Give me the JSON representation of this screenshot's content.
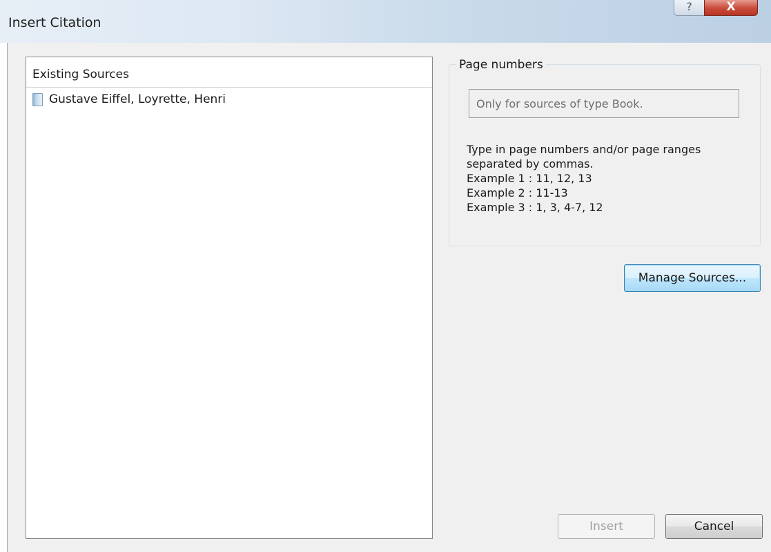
{
  "window": {
    "title": "Insert Citation",
    "help_label": "?",
    "close_label": "X"
  },
  "sources": {
    "header": "Existing Sources",
    "items": [
      {
        "label": "Gustave Eiffel, Loyrette, Henri",
        "icon": "book-icon"
      }
    ]
  },
  "page_numbers": {
    "legend": "Page numbers",
    "placeholder": "Only for sources of type Book.",
    "value": "",
    "instructions": [
      "Type in page numbers and/or page ranges",
      "separated by commas.",
      "Example 1 : 11, 12, 13",
      "Example 2 : 11-13",
      "Example 3 : 1, 3, 4-7, 12"
    ]
  },
  "buttons": {
    "manage_sources": "Manage Sources...",
    "insert": "Insert",
    "cancel": "Cancel"
  },
  "colors": {
    "dialog_background": "#f0f0f0",
    "close_button": "#c94a38",
    "focus_border": "#3c7fb1"
  }
}
